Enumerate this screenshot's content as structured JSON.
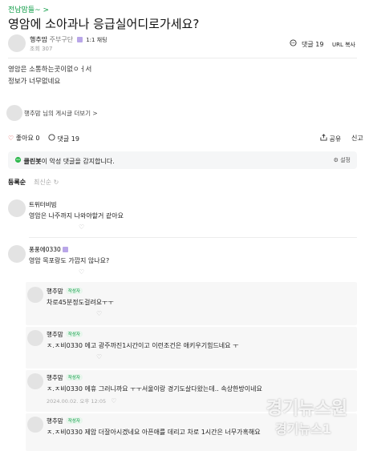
{
  "post": {
    "breadcrumb": "전남맘들~ >",
    "title": "영암에 소아과나 응급실어디로가세요?",
    "author": "행추맘",
    "grade": "주부구단",
    "chat_label": "1:1 채팅",
    "date": "",
    "views_label": "조회 307",
    "comment_tool_label": "댓글 19",
    "url_label": "URL 복사",
    "body_lines": [
      "영암은 소통하는곳이없ㅇㅓ서",
      "정보가 너무없네요"
    ],
    "author_card": "행추맘 님의 게시글 더보기 >"
  },
  "actions": {
    "like_label": "좋아요 0",
    "comment_label": "댓글 19",
    "share_label": "공유",
    "report_label": "신고"
  },
  "cleanbot": {
    "brand": "클린봇",
    "message": "이 악성 댓글을 감지합니다.",
    "setting_label": "설정"
  },
  "sort": {
    "registered": "등록순",
    "latest": "최신순"
  },
  "comments": [
    {
      "name": "트위터비빔",
      "text": "영암은 나주까지 나와야할거 같아요",
      "meta": "",
      "badge": ""
    },
    {
      "name": "풍풍에0330",
      "text": "영암 목포랑도 가깝지 않나요?",
      "meta": "",
      "badge": ""
    }
  ],
  "replies": [
    {
      "name": "행추맘",
      "badge": "작성자",
      "text": "차로45분정도걸려요ㅜㅜ",
      "meta": ""
    },
    {
      "name": "행추맘",
      "badge": "작성자",
      "text": "ㅈ.ㅈ비0330 에고 광주까진1시간이고 이런조건은 애키우기힘드네요 ㅜ",
      "meta": ""
    },
    {
      "name": "행추맘",
      "badge": "작성자",
      "text": "ㅈ.ㅈ비0330 에휴 그러니까요 ㅜㅜ서울이랑 경기도살다왔는데.. 속상한방이네요",
      "meta": "2024.00.02. 오후 12:05"
    },
    {
      "name": "행추맘",
      "badge": "작성자",
      "text": "ㅈ.ㅈ비0330 제암 더잘아시겠네요 아픈애를 데리고 차로 1시간은 너무가혹해요",
      "meta": ""
    }
  ],
  "watermark": {
    "line1": "경기뉴스원",
    "line2": "경기뉴스1"
  }
}
